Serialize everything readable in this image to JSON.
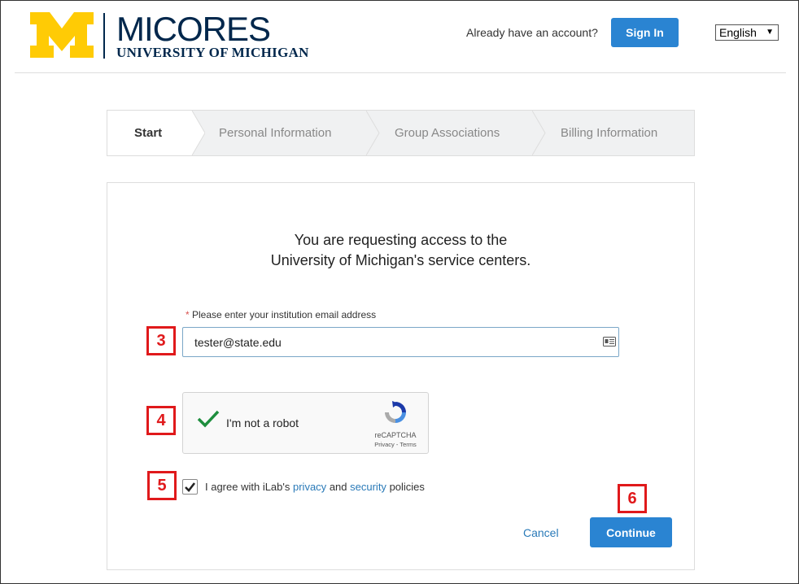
{
  "header": {
    "logo_title": "MICORES",
    "logo_subtitle": "UNIVERSITY OF MICHIGAN",
    "already_text": "Already have an account?",
    "signin_label": "Sign In",
    "language": "English"
  },
  "steps": [
    {
      "label": "Start",
      "active": true
    },
    {
      "label": "Personal Information",
      "active": false
    },
    {
      "label": "Group Associations",
      "active": false
    },
    {
      "label": "Billing Information",
      "active": false
    }
  ],
  "form": {
    "intro_line1": "You are requesting access to the",
    "intro_line2": "University of Michigan's service centers.",
    "email_required_mark": "*",
    "email_label": "Please enter your institution email address",
    "email_value": "tester@state.edu",
    "recaptcha_label": "I'm not a robot",
    "recaptcha_brand": "reCAPTCHA",
    "recaptcha_terms": "Privacy - Terms",
    "agree_prefix": "I agree with iLab's",
    "agree_privacy": "privacy",
    "agree_and": "and",
    "agree_security": "security",
    "agree_suffix": "policies",
    "agree_checked": true,
    "cancel_label": "Cancel",
    "continue_label": "Continue"
  },
  "callouts": [
    "3",
    "4",
    "5",
    "6"
  ],
  "colors": {
    "brand_navy": "#00274c",
    "brand_maize": "#ffcb05",
    "primary_button": "#2a84d2",
    "link": "#2a7ab8",
    "callout_red": "#e0191b",
    "check_green": "#1e8e3e"
  }
}
